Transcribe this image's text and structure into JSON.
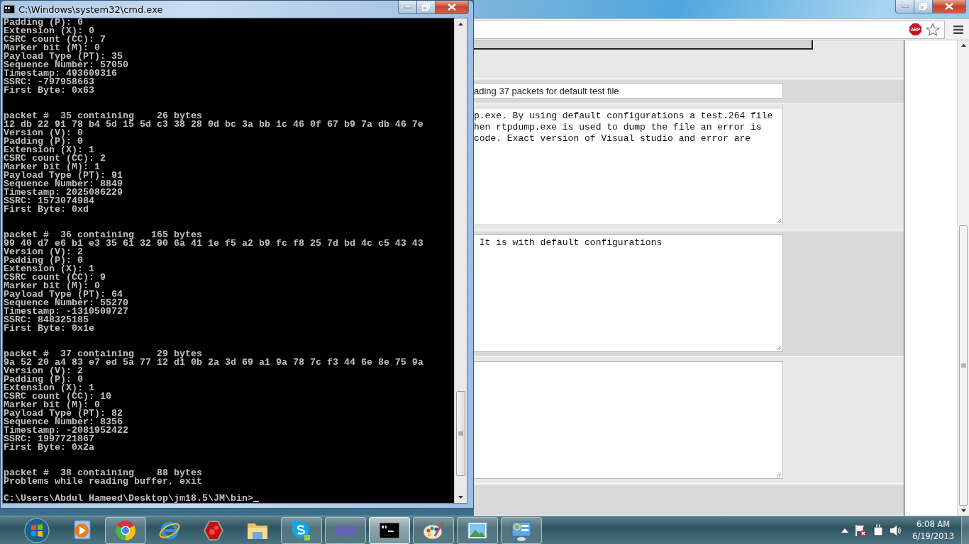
{
  "console_window": {
    "title": "C:\\Windows\\system32\\cmd.exe",
    "output_blocks": [
      [
        "Padding (P): 0",
        "Extension (X): 0",
        "CSRC count (CC): 7",
        "Marker bit (M): 0",
        "Payload Type (PT): 35",
        "Sequence Number: 57050",
        "Timestamp: 493609316",
        "SSRC: -797958663",
        "First Byte: 0x63"
      ],
      [
        "packet #  35 containing    26 bytes",
        "12 db 22 91 78 b4 5d 15 5d c3 38 28 0d bc 3a bb 1c 46 0f 67 b9 7a db 46 7e",
        "Version (V): 0",
        "Padding (P): 0",
        "Extension (X): 1",
        "CSRC count (CC): 2",
        "Marker bit (M): 1",
        "Payload Type (PT): 91",
        "Sequence Number: 8849",
        "Timestamp: 2025086229",
        "SSRC: 1573074984",
        "First Byte: 0xd"
      ],
      [
        "packet #  36 containing   165 bytes",
        "99 40 d7 e6 b1 e3 35 61 32 90 6a 41 1e f5 a2 b9 fc f8 25 7d bd 4c c5 43 43",
        "Version (V): 2",
        "Padding (P): 0",
        "Extension (X): 1",
        "CSRC count (CC): 9",
        "Marker bit (M): 0",
        "Payload Type (PT): 64",
        "Sequence Number: 55270",
        "Timestamp: -1310509727",
        "SSRC: 848325185",
        "First Byte: 0x1e"
      ],
      [
        "packet #  37 containing    29 bytes",
        "9a 52 20 a4 83 e7 ed 5a 77 12 d1 0b 2a 3d 69 a1 9a 78 7c f3 44 6e 8e 75 9a",
        "Version (V): 2",
        "Padding (P): 0",
        "Extension (X): 1",
        "CSRC count (CC): 10",
        "Marker bit (M): 0",
        "Payload Type (PT): 82",
        "Sequence Number: 8356",
        "Timestamp: -2081952422",
        "SSRC: 1997721867",
        "First Byte: 0x2a"
      ],
      [
        "packet #  38 containing    88 bytes",
        "Problems while reading buffer, exit"
      ]
    ],
    "prompt": "C:\\Users\\Abdul Hameed\\Desktop\\jm18.5\\JM\\bin>"
  },
  "browser_window": {
    "adblock_badge": "ABP",
    "fields": [
      {
        "kind": "input",
        "value": "ading 37 packets for default test file"
      },
      {
        "kind": "textarea",
        "lines": [
          "p.exe. By using default configurations a test.264 file",
          "hen rtpdump.exe is used to dump the file an error is",
          "code. Exact version of Visual studio and error are"
        ]
      },
      {
        "kind": "textarea",
        "lines": [
          " It is with default configurations"
        ]
      },
      {
        "kind": "textarea"
      }
    ]
  },
  "taskbar": {
    "apps": [
      {
        "kind": "media",
        "running": false,
        "selected": false
      },
      {
        "kind": "chrome",
        "running": true,
        "selected": false
      },
      {
        "kind": "ie",
        "running": false,
        "selected": false
      },
      {
        "kind": "hexagon",
        "running": false,
        "selected": false
      },
      {
        "kind": "folder",
        "running": false,
        "selected": false
      },
      {
        "kind": "skype",
        "running": true,
        "selected": false
      },
      {
        "kind": "infinity",
        "running": true,
        "selected": false
      },
      {
        "kind": "terminal",
        "running": true,
        "selected": true
      },
      {
        "kind": "paint",
        "running": true,
        "selected": false
      },
      {
        "kind": "picture",
        "running": true,
        "selected": false
      },
      {
        "kind": "dashboard",
        "running": true,
        "selected": false
      }
    ],
    "clock": {
      "time": "6:08 AM",
      "date": "6/19/2013"
    }
  }
}
